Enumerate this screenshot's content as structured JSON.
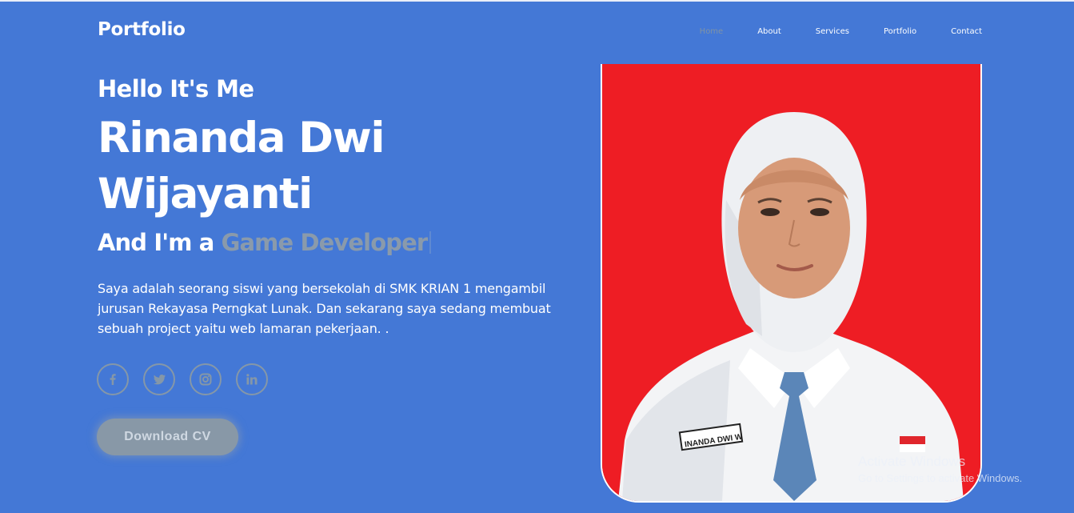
{
  "header": {
    "logo": "Portfolio",
    "nav": [
      {
        "label": "Home",
        "active": true
      },
      {
        "label": "About"
      },
      {
        "label": "Services"
      },
      {
        "label": "Portfolio"
      },
      {
        "label": "Contact"
      }
    ]
  },
  "hero": {
    "greeting": "Hello It's Me",
    "name_line1": "Rinanda Dwi",
    "name_line2": "Wijayanti",
    "role_prefix": "And I'm a",
    "role_typed": "Game Developer",
    "description": "Saya adalah seorang siswi yang bersekolah di SMK KRIAN 1 mengambil jurusan Rekayasa Perngkat Lunak. Dan sekarang saya sedang membuat sebuah project yaitu web lamaran pekerjaan. .",
    "socials": [
      {
        "icon": "facebook-icon"
      },
      {
        "icon": "twitter-icon"
      },
      {
        "icon": "instagram-icon"
      },
      {
        "icon": "linkedin-icon"
      }
    ],
    "cta_label": "Download CV",
    "name_tag": "INANDA DWI W"
  },
  "watermark": {
    "title": "Activate Windows",
    "subtitle": "Go to Settings to activate Windows."
  },
  "colors": {
    "background": "#4478d6",
    "photo_background": "#ee1d24",
    "muted_accent": "#8a9aab"
  }
}
